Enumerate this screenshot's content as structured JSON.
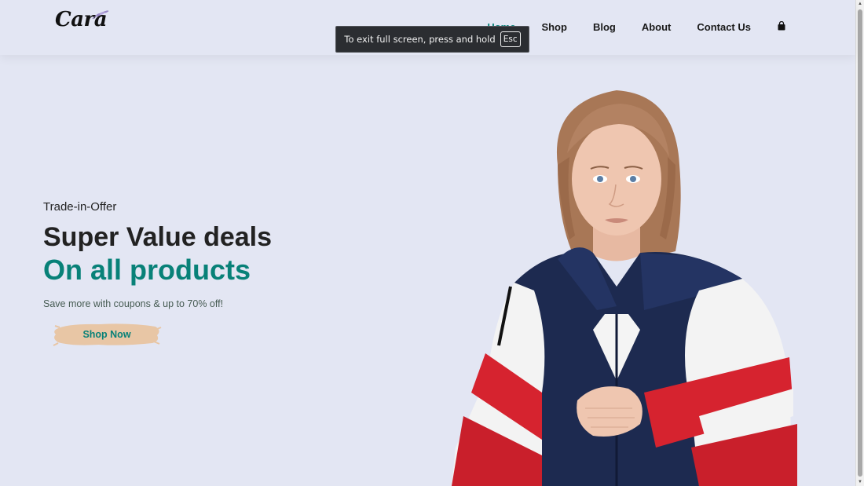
{
  "brand": {
    "logo_text": "Cara"
  },
  "nav": {
    "items": [
      {
        "label": "Home",
        "active": true
      },
      {
        "label": "Shop"
      },
      {
        "label": "Blog"
      },
      {
        "label": "About"
      },
      {
        "label": "Contact Us"
      }
    ],
    "cart_icon": "shopping-bag-icon"
  },
  "fullscreen_toast": {
    "message": "To exit full screen, press and hold",
    "key": "Esc"
  },
  "hero": {
    "kicker": "Trade-in-Offer",
    "headline": "Super Value deals",
    "subheadline": "On all products",
    "description": "Save more with coupons & up to 70% off!",
    "cta_label": "Shop Now"
  },
  "colors": {
    "background": "#e3e6f3",
    "accent": "#088178",
    "button_brush": "#e8c6a5",
    "text": "#222222"
  }
}
